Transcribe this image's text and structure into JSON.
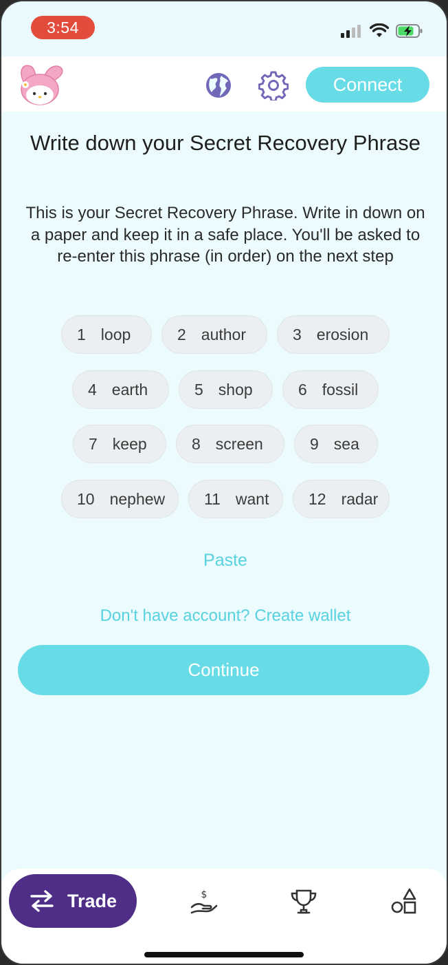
{
  "status_bar": {
    "time": "3:54"
  },
  "header": {
    "connect_label": "Connect"
  },
  "content": {
    "title": "Write down your Secret Recovery Phrase",
    "description": "This is your Secret Recovery Phrase. Write in down on a paper and keep it in a safe place. You'll be asked to re-enter this phrase (in order) on the next step",
    "words": [
      {
        "num": "1",
        "word": "loop"
      },
      {
        "num": "2",
        "word": "author"
      },
      {
        "num": "3",
        "word": "erosion"
      },
      {
        "num": "4",
        "word": "earth"
      },
      {
        "num": "5",
        "word": "shop"
      },
      {
        "num": "6",
        "word": "fossil"
      },
      {
        "num": "7",
        "word": "keep"
      },
      {
        "num": "8",
        "word": "screen"
      },
      {
        "num": "9",
        "word": "sea"
      },
      {
        "num": "10",
        "word": "nephew"
      },
      {
        "num": "11",
        "word": "want"
      },
      {
        "num": "12",
        "word": "radar"
      }
    ],
    "paste_label": "Paste",
    "create_wallet_label": "Don't have account? Create wallet",
    "continue_label": "Continue"
  },
  "bottom_nav": {
    "trade_label": "Trade",
    "items": [
      "trade-icon",
      "earn-icon",
      "trophy-icon",
      "shapes-icon"
    ]
  },
  "colors": {
    "accent": "#67dce6",
    "link": "#58d2e0",
    "nav_active": "#4e2e86",
    "background": "#ecfbfd",
    "time_pill": "#e24c3c"
  }
}
